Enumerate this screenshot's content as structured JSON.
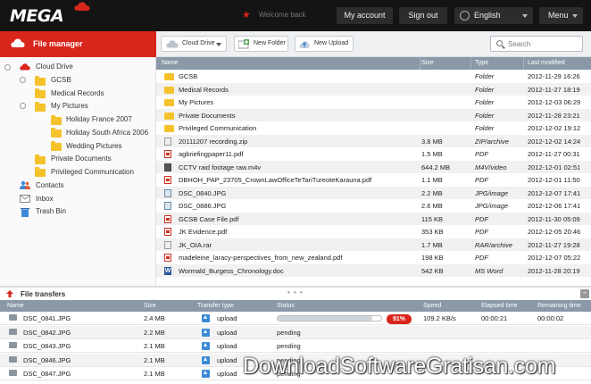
{
  "topbar": {
    "logo": "MEGA",
    "welcome": "Welcome back",
    "my_account": "My account",
    "sign_out": "Sign out",
    "language": "English",
    "menu": "Menu"
  },
  "sidebar": {
    "header": "File manager",
    "items": [
      {
        "label": "Cloud Drive"
      },
      {
        "label": "GCSB"
      },
      {
        "label": "Medical Records"
      },
      {
        "label": "My Pictures"
      },
      {
        "label": "Holiday France 2007"
      },
      {
        "label": "Holiday South Africa 2006"
      },
      {
        "label": "Wedding Pictures"
      },
      {
        "label": "Private Documents"
      },
      {
        "label": "Privileged Communication"
      },
      {
        "label": "Contacts"
      },
      {
        "label": "Inbox"
      },
      {
        "label": "Trash Bin"
      }
    ]
  },
  "toolbar": {
    "cloud_drive": "Cloud Drive",
    "new_folder": "New Folder",
    "new_upload": "New Upload",
    "search_placeholder": "Search"
  },
  "file_list": {
    "columns": [
      "Name",
      "Size",
      "Type",
      "Last modified"
    ],
    "rows": [
      {
        "name": "GCSB",
        "size": "",
        "type": "Folder",
        "date": "2012-11-29 16:26",
        "icon": "folder"
      },
      {
        "name": "Medical Records",
        "size": "",
        "type": "Folder",
        "date": "2012-11-27 18:19",
        "icon": "folder"
      },
      {
        "name": "My Pictures",
        "size": "",
        "type": "Folder",
        "date": "2012-12-03 06:29",
        "icon": "folder"
      },
      {
        "name": "Private Documents",
        "size": "",
        "type": "Folder",
        "date": "2012-11-28 23:21",
        "icon": "folder"
      },
      {
        "name": "Privileged Communication",
        "size": "",
        "type": "Folder",
        "date": "2012-12-02 19:12",
        "icon": "folder"
      },
      {
        "name": "20111207 recording.zip",
        "size": "3.8 MB",
        "type": "ZIP/archive",
        "date": "2012-12-02 14:24",
        "icon": "zip"
      },
      {
        "name": "agbriefingpaper11.pdf",
        "size": "1.5 MB",
        "type": "PDF",
        "date": "2012-11-27 00:31",
        "icon": "pdf"
      },
      {
        "name": "CCTV raid footage raw.m4v",
        "size": "644.2 MB",
        "type": "M4V/video",
        "date": "2012-12-01 02:51",
        "icon": "vid"
      },
      {
        "name": "DBHOH_PAP_23705_CrownLawOfficeTeTariTureoteKarauna.pdf",
        "size": "1.1 MB",
        "type": "PDF",
        "date": "2012-12-01 11:50",
        "icon": "pdf"
      },
      {
        "name": "DSC_0840.JPG",
        "size": "2.2 MB",
        "type": "JPG/image",
        "date": "2012-12-07 17:41",
        "icon": "img"
      },
      {
        "name": "DSC_0886.JPG",
        "size": "2.6 MB",
        "type": "JPG/image",
        "date": "2012-12-06 17:41",
        "icon": "img"
      },
      {
        "name": "GCSB Case File.pdf",
        "size": "115 KB",
        "type": "PDF",
        "date": "2012-11-30 05:09",
        "icon": "pdf"
      },
      {
        "name": "JK Evidence.pdf",
        "size": "353 KB",
        "type": "PDF",
        "date": "2012-12-05 20:46",
        "icon": "pdf"
      },
      {
        "name": "JK_OIA.rar",
        "size": "1.7 MB",
        "type": "RAR/archive",
        "date": "2012-11-27 19:28",
        "icon": "zip"
      },
      {
        "name": "madeleine_laracy-perspectives_from_new_zealand.pdf",
        "size": "198 KB",
        "type": "PDF",
        "date": "2012-12-07 05:22",
        "icon": "pdf"
      },
      {
        "name": "Wormald_Burgess_Chronology.doc",
        "size": "542 KB",
        "type": "MS Word",
        "date": "2012-11-28 20:19",
        "icon": "word"
      }
    ]
  },
  "transfers": {
    "title": "File transfers",
    "columns": [
      "Name",
      "Size",
      "Transfer type",
      "Status",
      "Speed",
      "Elapsed time",
      "Remaining time"
    ],
    "rows": [
      {
        "name": "DSC_0841.JPG",
        "size": "2.4 MB",
        "type": "upload",
        "status": "",
        "progress": 0.91,
        "pct": "91%",
        "speed": "109.2 KB/s",
        "elapsed": "00:00:21",
        "remaining": "00:00:02"
      },
      {
        "name": "DSC_0842.JPG",
        "size": "2.2 MB",
        "type": "upload",
        "status": "pending",
        "speed": "",
        "elapsed": "",
        "remaining": ""
      },
      {
        "name": "DSC_0843.JPG",
        "size": "2.1 MB",
        "type": "upload",
        "status": "pending",
        "speed": "",
        "elapsed": "",
        "remaining": ""
      },
      {
        "name": "DSC_0846.JPG",
        "size": "2.1 MB",
        "type": "upload",
        "status": "pending",
        "speed": "",
        "elapsed": "",
        "remaining": ""
      },
      {
        "name": "DSC_0847.JPG",
        "size": "2.1 MB",
        "type": "upload",
        "status": "pending",
        "speed": "",
        "elapsed": "",
        "remaining": ""
      }
    ]
  },
  "watermark": "DownloadSoftwareGratisan.com",
  "colors": {
    "brand_red": "#d9261c",
    "header_bar": "#141414",
    "column_header": "#8a98a8",
    "folder": "#f5c22c"
  }
}
